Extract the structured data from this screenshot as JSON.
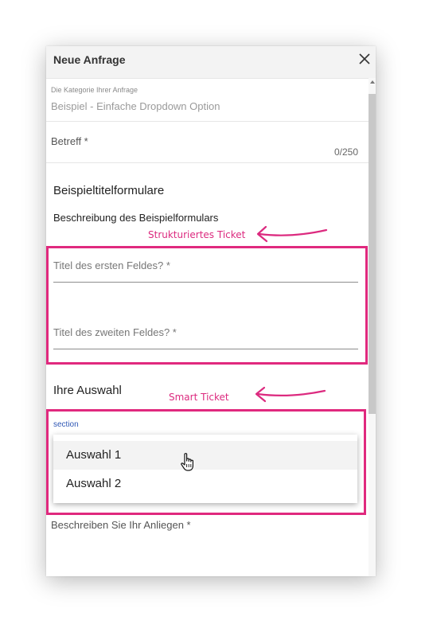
{
  "dialog": {
    "title": "Neue Anfrage",
    "close_icon": "close-icon"
  },
  "category": {
    "label": "Die Kategorie Ihrer Anfrage",
    "value": "Beispiel - Einfache Dropdown Option"
  },
  "betreff": {
    "label": "Betreff *",
    "counter": "0/250"
  },
  "form": {
    "title": "Beispieltitelformulare",
    "description": "Beschreibung des Beispielformulars",
    "field1_label": "Titel des ersten Feldes? *",
    "field2_label": "Titel des zweiten Feldes? *"
  },
  "auswahl": {
    "title": "Ihre Auswahl",
    "section_label": "section",
    "options": [
      "Auswahl 1",
      "Auswahl 2"
    ]
  },
  "describe": {
    "label": "Beschreiben Sie Ihr Anliegen *"
  },
  "annotations": {
    "structured": "Strukturiertes Ticket",
    "smart": "Smart Ticket",
    "color": "#e0297e"
  },
  "cursor_icon": "hand-pointer-icon"
}
